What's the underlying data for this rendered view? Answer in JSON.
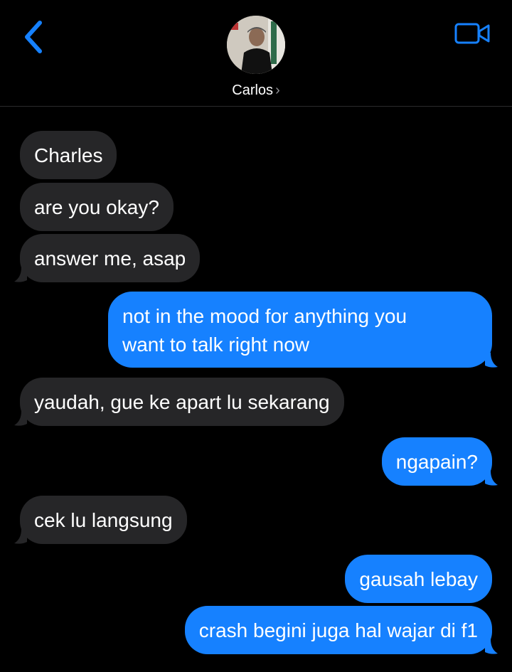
{
  "header": {
    "contact_name": "Carlos",
    "chevron": "›",
    "back_icon": "chevron-left-icon",
    "video_icon": "video-camera-icon",
    "accent_color": "#1681ff"
  },
  "messages": [
    {
      "from": "them",
      "text": "Charles"
    },
    {
      "from": "them",
      "text": "are you okay?"
    },
    {
      "from": "them",
      "text": "answer me, asap"
    },
    {
      "from": "me",
      "line1": "not in the mood for anything you",
      "line2": "want to talk right now"
    },
    {
      "from": "them",
      "text": "yaudah, gue ke apart lu sekarang"
    },
    {
      "from": "me",
      "text": "ngapain?"
    },
    {
      "from": "them",
      "text": "cek lu langsung"
    },
    {
      "from": "me",
      "text": "gausah lebay"
    },
    {
      "from": "me",
      "text": "crash begini juga hal wajar di f1"
    }
  ]
}
